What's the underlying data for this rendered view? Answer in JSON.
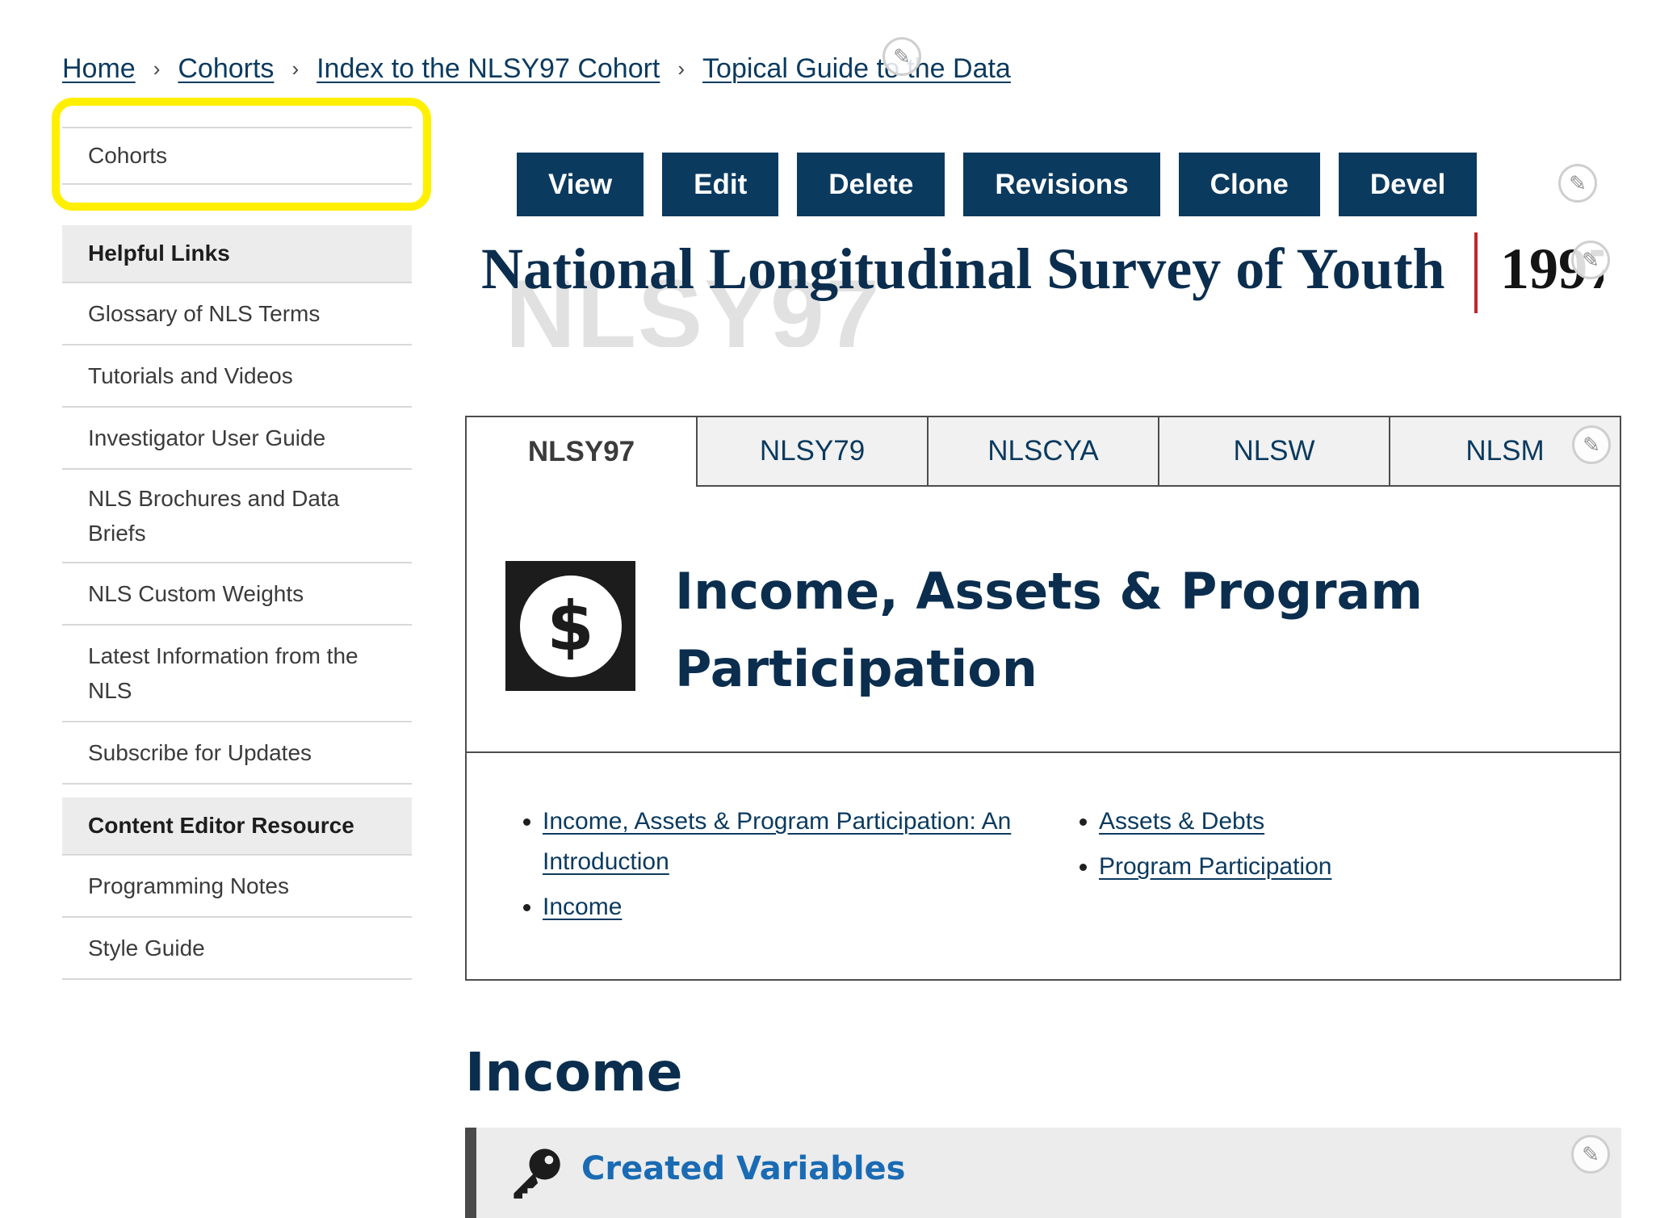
{
  "breadcrumb": {
    "items": [
      "Home",
      "Cohorts",
      "Index to the NLSY97 Cohort",
      "Topical Guide to the Data"
    ],
    "separator": "›"
  },
  "sidebar": {
    "top_item": "Cohorts",
    "highlight_color": "#ffef00",
    "sections": [
      {
        "title": "Helpful Links",
        "items": [
          "Glossary of NLS Terms",
          "Tutorials and Videos",
          "Investigator User Guide",
          "NLS Brochures and Data Briefs",
          "NLS Custom Weights",
          "Latest Information from the NLS",
          "Subscribe for Updates"
        ]
      },
      {
        "title": "Content Editor Resource",
        "items": [
          "Programming Notes",
          "Style Guide"
        ]
      }
    ]
  },
  "actions": [
    "View",
    "Edit",
    "Delete",
    "Revisions",
    "Clone",
    "Devel"
  ],
  "banner": {
    "title": "National Longitudinal Survey of Youth",
    "year": "1997",
    "watermark": "NLSY97"
  },
  "tabs": {
    "items": [
      "NLSY97",
      "NLSY79",
      "NLSCYA",
      "NLSW",
      "NLSM"
    ],
    "active": "NLSY97"
  },
  "topic": {
    "icon": "dollar-circle-icon",
    "title": "Income, Assets & Program Participation",
    "links_left": [
      "Income, Assets & Program Participation: An Introduction",
      "Income"
    ],
    "links_right": [
      "Assets & Debts",
      "Program Participation"
    ]
  },
  "section": {
    "heading": "Income",
    "created_variables": {
      "icon": "key-icon",
      "title": "Created Variables"
    }
  },
  "colors": {
    "brand_navy": "#0b3a5f",
    "accent_red": "#c0272d",
    "link_blue": "#1a6bb3"
  }
}
